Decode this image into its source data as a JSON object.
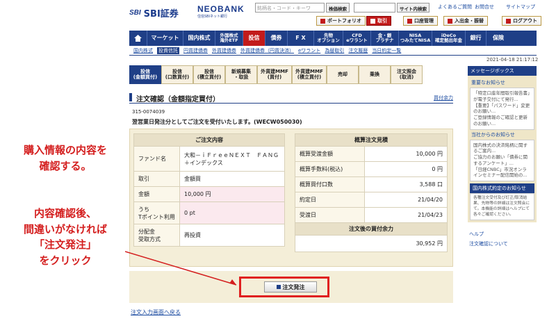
{
  "header": {
    "sbi_mark": "SBI",
    "sbi_name": "SBI証券",
    "neo_name": "NEOBANK",
    "neo_sub": "住信SBIネット銀行",
    "search_placeholder": "銘柄名・コード・キーワ",
    "stock_search": "株価検索",
    "site_search": "サイト内検索",
    "links": [
      "よくあるご質問",
      "お問合せ",
      "サイトマップ"
    ],
    "portfolio": "ポートフォリオ",
    "trade": "取引",
    "account": "口座管理",
    "deposit": "入出金・振替",
    "logout": "ログアウト"
  },
  "gnav": [
    "マーケット",
    "国内株式",
    "外国株式\n海外ETF",
    "投信",
    "債券",
    "F X",
    "先物\nオプション",
    "CFD\neワラント",
    "金・銀\nプラチナ",
    "NISA\nつみたてNISA",
    "iDeCo\n確定拠出年金",
    "銀行",
    "保険"
  ],
  "subnav": [
    "国内株式",
    "投資信託",
    "円貨建債券",
    "外貨建債券",
    "外貨建債券（円貨決済）",
    "eワラント",
    "為替取引",
    "注文履歴",
    "当日約定一覧"
  ],
  "datetime": "2021-04-18 21:17:12",
  "tabs": [
    "投信\n(金額買付)",
    "投信\n(口数買付)",
    "投信\n(積立買付)",
    "新規募集\n・取扱",
    "外貨建MMF\n(買付)",
    "外貨建MMF\n(積立買付)",
    "売却",
    "乗換",
    "注文照会\n(取消)"
  ],
  "page": {
    "title": "注文確認（金額指定買付）",
    "tradable_link": "買付余力",
    "order_no": "315-0074039",
    "message": "翌営業日発注分としてご注文を受付いたします。(WECW050030)"
  },
  "order_table": {
    "header": "ご注文内容",
    "rows": [
      {
        "label": "ファンド名",
        "value": "大和－ｉＦｒｅｅＮＥＸＴ　ＦＡＮＧ＋インデックス"
      },
      {
        "label": "取引",
        "value": "金額買"
      },
      {
        "label": "金額",
        "value": "10,000 円"
      },
      {
        "label": "うち\nTポイント利用",
        "value": "0 pt"
      },
      {
        "label": "分配金\n受取方式",
        "value": "再投資"
      }
    ]
  },
  "estimate_table": {
    "header": "概算注文見積",
    "rows": [
      {
        "label": "概算受渡金額",
        "value": "10,000 円"
      },
      {
        "label": "概算手数料(税込)",
        "value": "0 円"
      },
      {
        "label": "概算買付口数",
        "value": "3,588 口"
      },
      {
        "label": "約定日",
        "value": "21/04/20"
      },
      {
        "label": "受渡日",
        "value": "21/04/23"
      }
    ],
    "after_header": "注文後の買付余力",
    "after_value": "30,952 円"
  },
  "submit_label": "注文発注",
  "back_link": "注文入力画面へ戻る",
  "sidebar": {
    "message_box": "メッセージボックス",
    "important": "重要なお知らせ",
    "important_items": [
      "「特定口座年間取引報告書」が電子交付にて発行...",
      "【重要】「パスワード」変更のお願い...",
      "ご登録情報のご確認と更新のお願い..."
    ],
    "notice": "当社からのお知らせ",
    "notice_items": [
      "国内株式の決済銘柄に関するご案内...",
      "ご協力のお願い「債券に関するアンケート」...",
      "「日経CNBC」市況オンラインセミナー配信開始の..."
    ],
    "deal_notice": "国内株式約定のお知らせ",
    "deal_text": "各種注文受付及び訂正/取消結果、先物等の詳細は注文照会にて。本機能の詳細はヘルプにて各々ご確認ください。",
    "help": "ヘルプ",
    "order_confirm": "注文確認について"
  },
  "annotations": {
    "a1_l1": "購入情報の内容を",
    "a1_l2": "確認する。",
    "a2_l1": "内容確認後、",
    "a2_l2": "間違いがなければ",
    "a2_l3": "「注文発注」",
    "a2_l4": "をクリック",
    "color": "#d41e1e"
  }
}
